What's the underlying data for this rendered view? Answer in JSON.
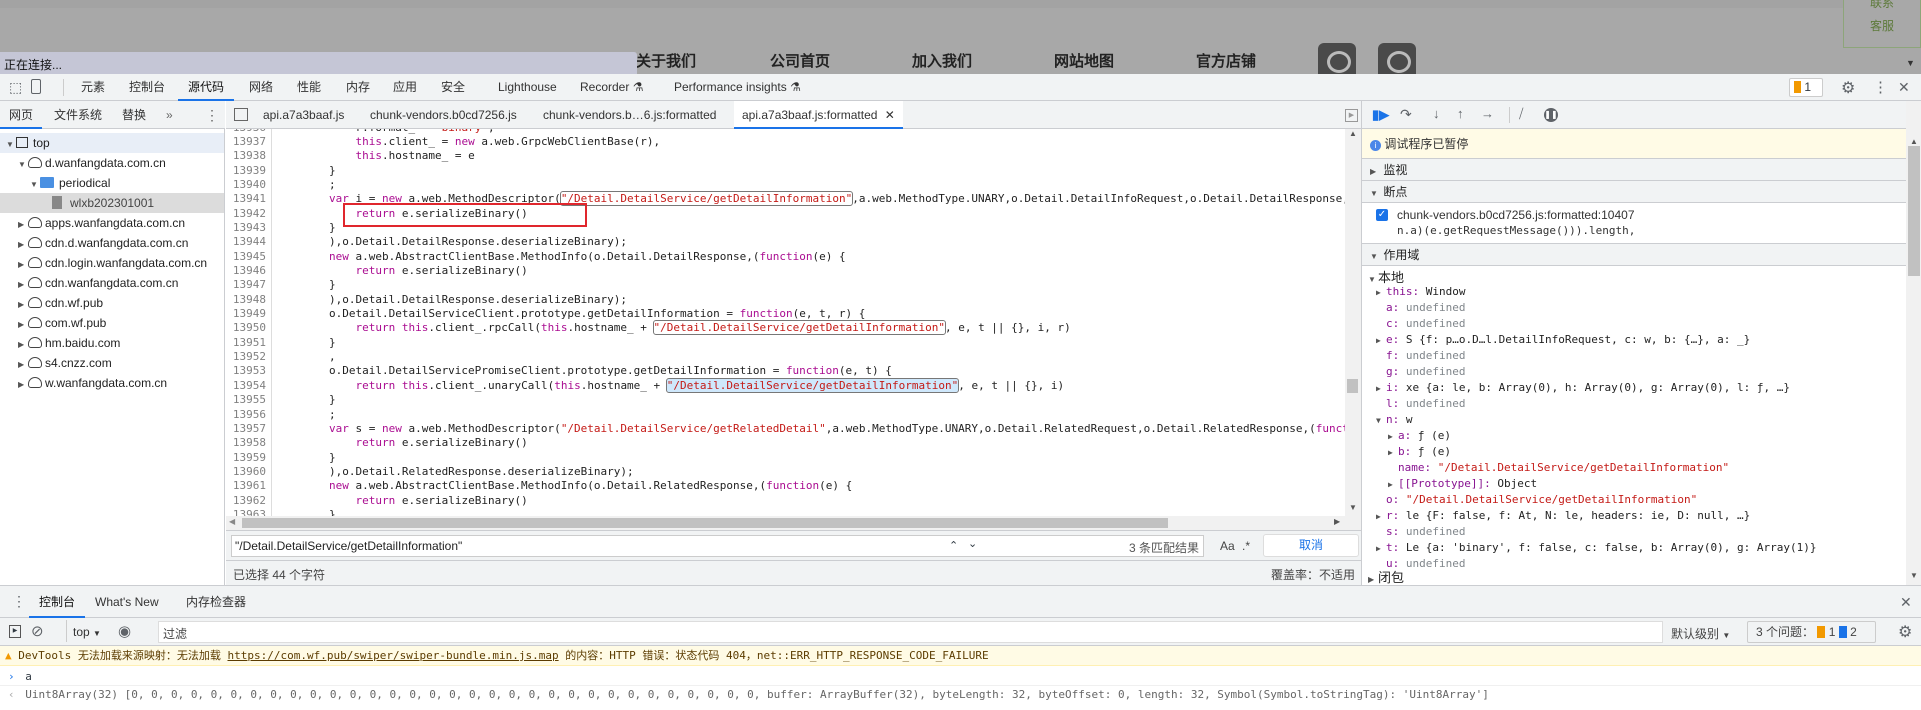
{
  "webpage": {
    "nav_links": [
      "关于我们",
      "公司首页",
      "加入我们",
      "网站地图",
      "官方店铺"
    ],
    "contact_label_1": "联系",
    "contact_label_2": "客服",
    "status_text": "正在连接..."
  },
  "devtools": {
    "main_tabs": [
      "元素",
      "控制台",
      "源代码",
      "网络",
      "性能",
      "内存",
      "应用",
      "安全",
      "Lighthouse",
      "Recorder",
      "Performance insights"
    ],
    "active_tab": "源代码",
    "issues_badge_count": "1",
    "navigator": {
      "tabs": [
        "网页",
        "文件系统",
        "替换"
      ],
      "more": "»",
      "tree": [
        {
          "label": "top",
          "level": 0,
          "icon": "frame-icon",
          "expanded": true
        },
        {
          "label": "d.wanfangdata.com.cn",
          "level": 1,
          "icon": "cloud-icon",
          "expanded": true
        },
        {
          "label": "periodical",
          "level": 2,
          "icon": "folder-icon",
          "expanded": true
        },
        {
          "label": "wlxb202301001",
          "level": 3,
          "icon": "file-icon",
          "selected": true
        },
        {
          "label": "apps.wanfangdata.com.cn",
          "level": 1,
          "icon": "cloud-icon",
          "expanded": false
        },
        {
          "label": "cdn.d.wanfangdata.com.cn",
          "level": 1,
          "icon": "cloud-icon",
          "expanded": false
        },
        {
          "label": "cdn.login.wanfangdata.com.cn",
          "level": 1,
          "icon": "cloud-icon",
          "expanded": false
        },
        {
          "label": "cdn.wanfangdata.com.cn",
          "level": 1,
          "icon": "cloud-icon",
          "expanded": false
        },
        {
          "label": "cdn.wf.pub",
          "level": 1,
          "icon": "cloud-icon",
          "expanded": false
        },
        {
          "label": "com.wf.pub",
          "level": 1,
          "icon": "cloud-icon",
          "expanded": false
        },
        {
          "label": "hm.baidu.com",
          "level": 1,
          "icon": "cloud-icon",
          "expanded": false
        },
        {
          "label": "s4.cnzz.com",
          "level": 1,
          "icon": "cloud-icon",
          "expanded": false
        },
        {
          "label": "w.wanfangdata.com.cn",
          "level": 1,
          "icon": "cloud-icon",
          "expanded": false
        }
      ]
    },
    "editor": {
      "tabs": [
        "api.a7a3baaf.js",
        "chunk-vendors.b0cd7256.js",
        "chunk-vendors.b…6.js:formatted",
        "api.a7a3baaf.js:formatted"
      ],
      "active_tab_index": 3,
      "search_term": "\"/Detail.DetailService/getDetailInformation\"",
      "current_match_line": 13954,
      "highlight_box_line": 13942,
      "lines": [
        {
          "n": 13936,
          "t": "            r.format_ = \"binary\","
        },
        {
          "n": 13937,
          "t": "            this.client_ = new a.web.GrpcWebClientBase(r),"
        },
        {
          "n": 13938,
          "t": "            this.hostname_ = e"
        },
        {
          "n": 13939,
          "t": "        }"
        },
        {
          "n": 13940,
          "t": "        ;"
        },
        {
          "n": 13941,
          "t": "        var i = new a.web.MethodDescriptor(\"/Detail.DetailService/getDetailInformation\",a.web.MethodType.UNARY,o.Detail.DetailInfoRequest,o.Detail.DetailResponse,"
        },
        {
          "n": 13942,
          "t": "            return e.serializeBinary()"
        },
        {
          "n": 13943,
          "t": "        }"
        },
        {
          "n": 13944,
          "t": "        ),o.Detail.DetailResponse.deserializeBinary);"
        },
        {
          "n": 13945,
          "t": "        new a.web.AbstractClientBase.MethodInfo(o.Detail.DetailResponse,(function(e) {"
        },
        {
          "n": 13946,
          "t": "            return e.serializeBinary()"
        },
        {
          "n": 13947,
          "t": "        }"
        },
        {
          "n": 13948,
          "t": "        ),o.Detail.DetailResponse.deserializeBinary);"
        },
        {
          "n": 13949,
          "t": "        o.Detail.DetailServiceClient.prototype.getDetailInformation = function(e, t, r) {"
        },
        {
          "n": 13950,
          "t": "            return this.client_.rpcCall(this.hostname_ + \"/Detail.DetailService/getDetailInformation\", e, t || {}, i, r)"
        },
        {
          "n": 13951,
          "t": "        }"
        },
        {
          "n": 13952,
          "t": "        ,"
        },
        {
          "n": 13953,
          "t": "        o.Detail.DetailServicePromiseClient.prototype.getDetailInformation = function(e, t) {"
        },
        {
          "n": 13954,
          "t": "            return this.client_.unaryCall(this.hostname_ + \"/Detail.DetailService/getDetailInformation\", e, t || {}, i)"
        },
        {
          "n": 13955,
          "t": "        }"
        },
        {
          "n": 13956,
          "t": "        ;"
        },
        {
          "n": 13957,
          "t": "        var s = new a.web.MethodDescriptor(\"/Detail.DetailService/getRelatedDetail\",a.web.MethodType.UNARY,o.Detail.RelatedRequest,o.Detail.RelatedResponse,(function(e) {"
        },
        {
          "n": 13958,
          "t": "            return e.serializeBinary()"
        },
        {
          "n": 13959,
          "t": "        }"
        },
        {
          "n": 13960,
          "t": "        ),o.Detail.RelatedResponse.deserializeBinary);"
        },
        {
          "n": 13961,
          "t": "        new a.web.AbstractClientBase.MethodInfo(o.Detail.RelatedResponse,(function(e) {"
        },
        {
          "n": 13962,
          "t": "            return e.serializeBinary()"
        },
        {
          "n": 13963,
          "t": "        }"
        }
      ],
      "search_value": "\"/Detail.DetailService/getDetailInformation\"",
      "match_count": "3 条匹配结果",
      "case_label": "Aa",
      "regex_label": ".*",
      "cancel_label": "取消",
      "selection_status": "已选择 44 个字符",
      "coverage_status": "覆盖率：不适用"
    },
    "debugger": {
      "paused_message": "调试程序已暂停",
      "watch_label": "监视",
      "breakpoints_label": "断点",
      "breakpoint": {
        "location": "chunk-vendors.b0cd7256.js:formatted:10407",
        "code": "n.a)(e.getRequestMessage())).length,",
        "checked": true
      },
      "scope_label": "作用域",
      "local_label": "本地",
      "closure_label": "闭包",
      "scope": [
        {
          "key": "this",
          "value": "Window",
          "type": "obj",
          "arrow": "collapsed",
          "level": 0
        },
        {
          "key": "a",
          "value": "undefined",
          "type": "undef",
          "level": 0
        },
        {
          "key": "c",
          "value": "undefined",
          "type": "undef",
          "level": 0
        },
        {
          "key": "e",
          "value": "S {f: p…o.D…l.DetailInfoRequest, c: w, b: {…}, a: _}",
          "type": "obj",
          "arrow": "collapsed",
          "level": 0
        },
        {
          "key": "f",
          "value": "undefined",
          "type": "undef",
          "level": 0
        },
        {
          "key": "g",
          "value": "undefined",
          "type": "undef",
          "level": 0
        },
        {
          "key": "i",
          "value": "xe {a: le, b: Array(0), h: Array(0), g: Array(0), l: ƒ, …}",
          "type": "obj",
          "arrow": "collapsed",
          "level": 0
        },
        {
          "key": "l",
          "value": "undefined",
          "type": "undef",
          "level": 0
        },
        {
          "key": "n",
          "value": "w",
          "type": "obj",
          "arrow": "expanded",
          "level": 0
        },
        {
          "key": "a",
          "value": "ƒ (e)",
          "type": "obj",
          "arrow": "collapsed",
          "level": 1
        },
        {
          "key": "b",
          "value": "ƒ (e)",
          "type": "obj",
          "arrow": "collapsed",
          "level": 1
        },
        {
          "key": "name",
          "value": "\"/Detail.DetailService/getDetailInformation\"",
          "type": "str",
          "level": 1
        },
        {
          "key": "[[Prototype]]",
          "value": "Object",
          "type": "obj",
          "arrow": "collapsed",
          "level": 1
        },
        {
          "key": "o",
          "value": "\"/Detail.DetailService/getDetailInformation\"",
          "type": "str",
          "level": 0
        },
        {
          "key": "r",
          "value": "le {F: false, f: At, N: le, headers: ie, D: null, …}",
          "type": "obj",
          "arrow": "collapsed",
          "level": 0
        },
        {
          "key": "s",
          "value": "undefined",
          "type": "undef",
          "level": 0
        },
        {
          "key": "t",
          "value": "Le {a: 'binary', f: false, c: false, b: Array(0), g: Array(1)}",
          "type": "obj",
          "arrow": "collapsed",
          "level": 0
        },
        {
          "key": "u",
          "value": "undefined",
          "type": "undef",
          "level": 0
        }
      ]
    },
    "drawer": {
      "tabs": [
        "控制台",
        "What's New",
        "内存检查器"
      ],
      "context": "top",
      "filter_placeholder": "过滤",
      "level_label": "默认级别",
      "issues_label": "3 个问题：",
      "issues_warn": "1",
      "issues_info": "2",
      "warning": {
        "prefix": "DevTools 无法加载来源映射：无法加载 ",
        "url": "https://com.wf.pub/swiper/swiper-bundle.min.js.map",
        "suffix": " 的内容：HTTP 错误：状态代码 404，net::ERR_HTTP_RESPONSE_CODE_FAILURE"
      },
      "input_echo": "a",
      "output": "Uint8Array(32) [0, 0, 0, 0, 0, 0, 0, 0, 0, 0, 0, 0, 0, 0, 0, 0, 0, 0, 0, 0, 0, 0, 0, 0, 0, 0, 0, 0, 0, 0, 0, 0, buffer: ArrayBuffer(32), byteLength: 32, byteOffset: 0, length: 32, Symbol(Symbol.toStringTag): 'Uint8Array']"
    },
    "colors": {
      "accent": "#1a73e8",
      "highlight_box": "#e0262d",
      "warning_bg": "#fffbe5",
      "keyword": "#aa0d91",
      "string": "#c41a16"
    }
  }
}
